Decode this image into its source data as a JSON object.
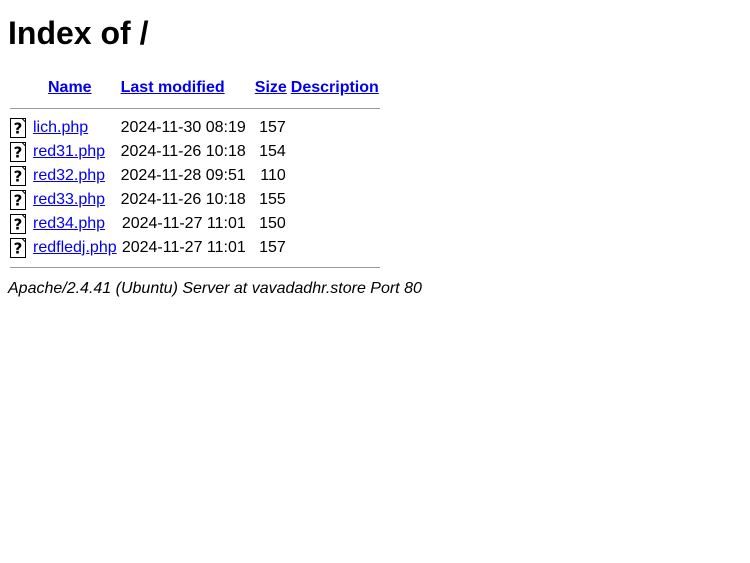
{
  "page": {
    "title": "Index of /"
  },
  "table": {
    "headers": {
      "name": "Name",
      "last_modified": "Last modified",
      "size": "Size",
      "description": "Description"
    },
    "rows": [
      {
        "icon": "unknown-file-icon",
        "name": "lich.php",
        "modified": "2024-11-30 08:19",
        "size": "157",
        "description": ""
      },
      {
        "icon": "unknown-file-icon",
        "name": "red31.php",
        "modified": "2024-11-26 10:18",
        "size": "154",
        "description": ""
      },
      {
        "icon": "unknown-file-icon",
        "name": "red32.php",
        "modified": "2024-11-28 09:51",
        "size": "110",
        "description": ""
      },
      {
        "icon": "unknown-file-icon",
        "name": "red33.php",
        "modified": "2024-11-26 10:18",
        "size": "155",
        "description": ""
      },
      {
        "icon": "unknown-file-icon",
        "name": "red34.php",
        "modified": "2024-11-27 11:01",
        "size": "150",
        "description": ""
      },
      {
        "icon": "unknown-file-icon",
        "name": "redfledj.php",
        "modified": "2024-11-27 11:01",
        "size": "157",
        "description": ""
      }
    ]
  },
  "footer": {
    "server_signature": "Apache/2.4.41 (Ubuntu) Server at vavadadhr.store Port 80"
  },
  "colors": {
    "link": "#0000ee",
    "rule": "#9a9a9a"
  }
}
